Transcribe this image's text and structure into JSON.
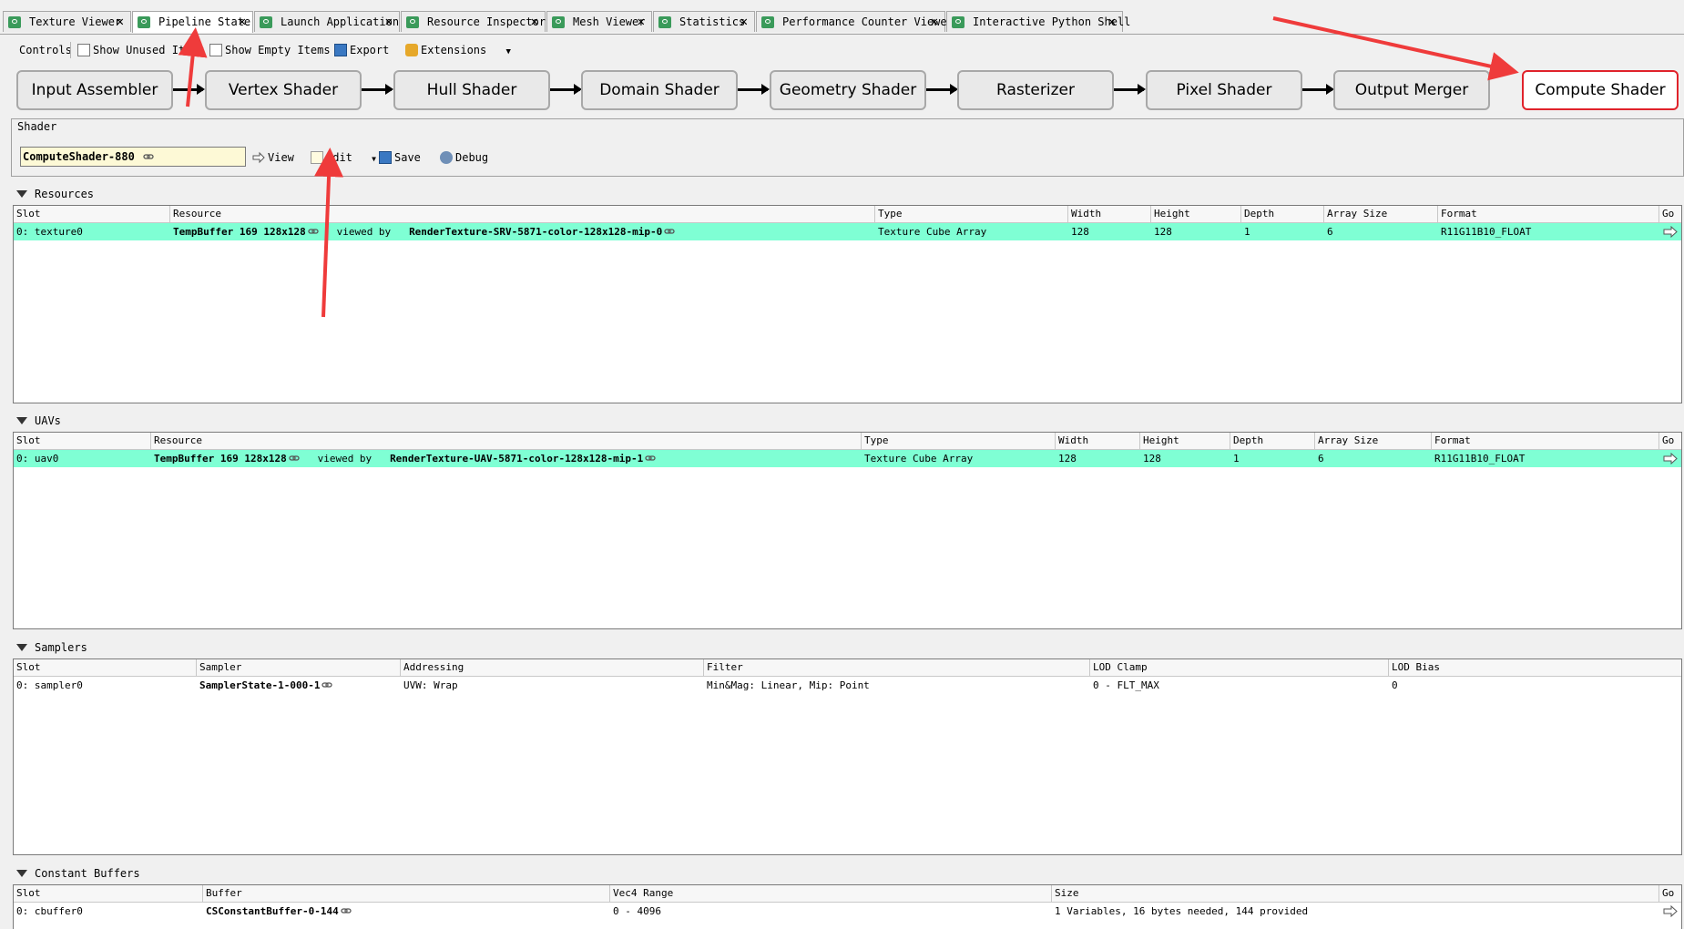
{
  "tabs": [
    {
      "label": "Texture Viewer",
      "active": false
    },
    {
      "label": "Pipeline State",
      "active": true
    },
    {
      "label": "Launch Application",
      "active": false
    },
    {
      "label": "Resource Inspector",
      "active": false
    },
    {
      "label": "Mesh Viewer",
      "active": false
    },
    {
      "label": "Statistics",
      "active": false
    },
    {
      "label": "Performance Counter Viewer",
      "active": false
    },
    {
      "label": "Interactive Python Shell",
      "active": false
    }
  ],
  "toolbar": {
    "controls": "Controls",
    "show_unused": "Show Unused Items",
    "show_empty": "Show Empty Items",
    "export": "Export",
    "extensions": "Extensions"
  },
  "stages": [
    "Input Assembler",
    "Vertex Shader",
    "Hull Shader",
    "Domain Shader",
    "Geometry Shader",
    "Rasterizer",
    "Pixel Shader",
    "Output Merger",
    "Compute Shader"
  ],
  "current_stage": "Compute Shader",
  "shader": {
    "group_title": "Shader",
    "name": "ComputeShader-880",
    "view": "View",
    "edit": "Edit",
    "save": "Save",
    "debug": "Debug"
  },
  "resources": {
    "title": "Resources",
    "columns": [
      "Slot",
      "Resource",
      "Type",
      "Width",
      "Height",
      "Depth",
      "Array Size",
      "Format",
      "Go"
    ],
    "rows": [
      {
        "slot": "0: texture0",
        "resource": "TempBuffer 169 128x128",
        "viewed_by": "viewed  by",
        "view": "RenderTexture-SRV-5871-color-128x128-mip-0",
        "type": "Texture Cube Array",
        "width": "128",
        "height": "128",
        "depth": "1",
        "array_size": "6",
        "format": "R11G11B10_FLOAT"
      }
    ]
  },
  "uavs": {
    "title": "UAVs",
    "columns": [
      "Slot",
      "Resource",
      "Type",
      "Width",
      "Height",
      "Depth",
      "Array Size",
      "Format",
      "Go"
    ],
    "rows": [
      {
        "slot": "0: uav0",
        "resource": "TempBuffer 169 128x128",
        "viewed_by": "viewed  by",
        "view": "RenderTexture-UAV-5871-color-128x128-mip-1",
        "type": "Texture Cube Array",
        "width": "128",
        "height": "128",
        "depth": "1",
        "array_size": "6",
        "format": "R11G11B10_FLOAT"
      }
    ]
  },
  "samplers": {
    "title": "Samplers",
    "columns": [
      "Slot",
      "Sampler",
      "Addressing",
      "Filter",
      "LOD Clamp",
      "LOD Bias"
    ],
    "rows": [
      {
        "slot": "0: sampler0",
        "sampler": "SamplerState-1-000-1",
        "addressing": "UVW: Wrap",
        "filter": "Min&Mag: Linear, Mip: Point",
        "lod_clamp": "0 - FLT_MAX",
        "lod_bias": "0"
      }
    ]
  },
  "cbuffers": {
    "title": "Constant Buffers",
    "columns": [
      "Slot",
      "Buffer",
      "Vec4 Range",
      "Size",
      "Go"
    ],
    "rows": [
      {
        "slot": "0: cbuffer0",
        "buffer": "CSConstantBuffer-0-144",
        "range": "0 - 4096",
        "size": "1 Variables, 16 bytes needed, 144 provided"
      }
    ]
  },
  "colors": {
    "highlight_row": "#7fffd4",
    "current_stage_border": "#e0232b",
    "shader_name_bg": "#fdf9d6",
    "annotation_arrow": "#ef3b3b"
  }
}
